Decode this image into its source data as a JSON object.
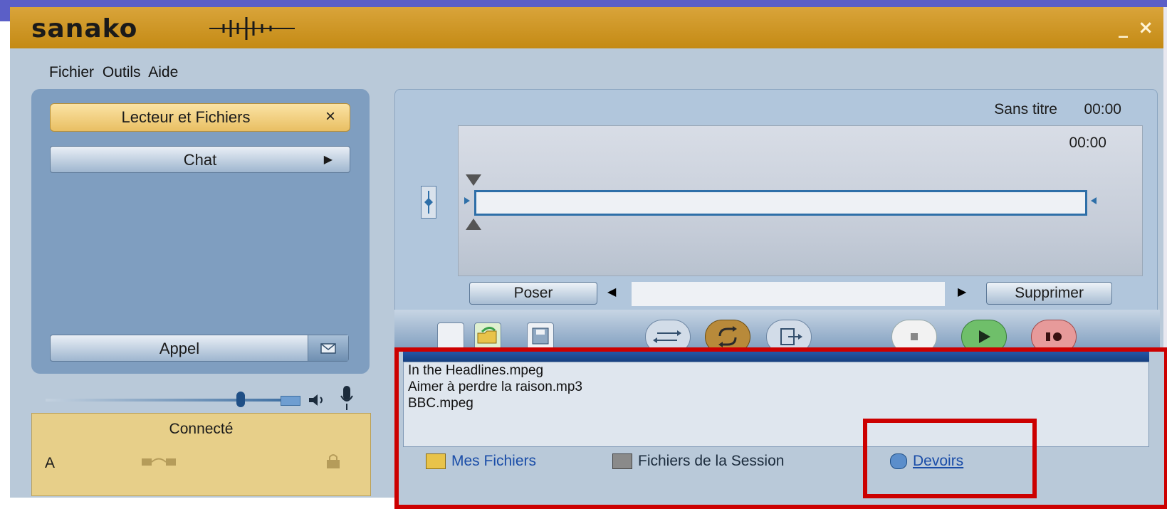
{
  "window": {
    "logo": "sanako",
    "minimize_icon": "minimize-icon",
    "close_icon": "close-icon",
    "minimize_glyph": "_",
    "close_glyph": "×"
  },
  "menu": [
    "Fichier",
    "Outils",
    "Aide"
  ],
  "left_panel": {
    "active_button": "Lecteur et Fichiers",
    "active_button_close": "×",
    "chat_button": "Chat",
    "chat_arrow": "▶",
    "call_button": "Appel"
  },
  "volume": {
    "level": 0.82
  },
  "status": {
    "title": "Connecté",
    "user": "A"
  },
  "player": {
    "title": "Sans titre",
    "time_total": "00:00",
    "time_position": "00:00",
    "left_button": "Poser",
    "right_button": "Supprimer",
    "prev_glyph": "◀",
    "next_glyph": "▶"
  },
  "files": {
    "items": [
      "In the Headlines.mpeg",
      "Aimer à perdre la raison.mp3",
      "BBC.mpeg"
    ],
    "tabs": [
      "Mes Fichiers",
      "Fichiers de la Session",
      "Devoirs"
    ],
    "active_tab": "Devoirs"
  },
  "colors": {
    "titlebar": "#c48a14",
    "highlight": "#cc0000",
    "accent": "#1a4da8"
  }
}
